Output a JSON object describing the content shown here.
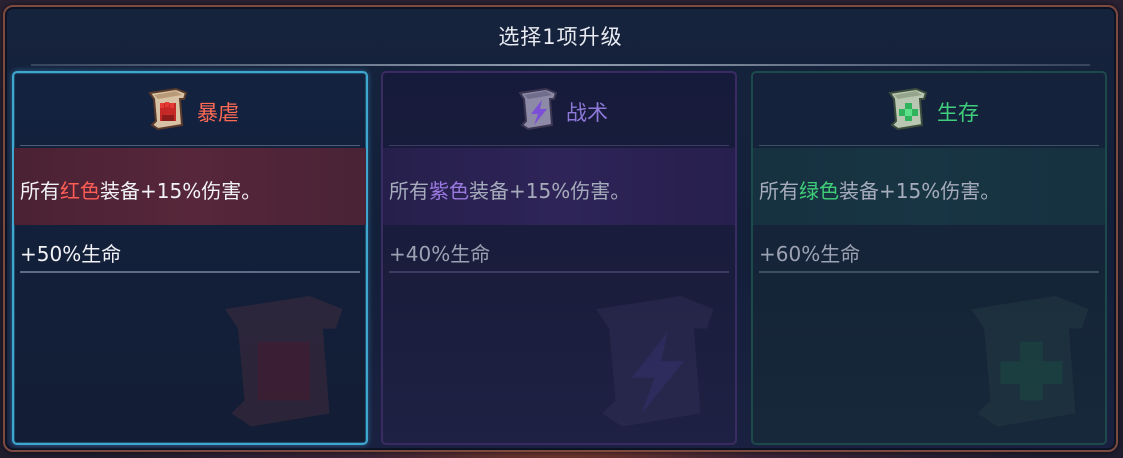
{
  "panel": {
    "title": "选择1项升级"
  },
  "cards": [
    {
      "category": "暴虐",
      "icon": "red-fist-scroll-icon",
      "accent": "#ff6a55",
      "desc_prefix": "所有",
      "desc_highlight": "红色",
      "desc_suffix": "装备+15%伤害。",
      "bonus": "+50%生命",
      "selected": true
    },
    {
      "category": "战术",
      "icon": "purple-lightning-scroll-icon",
      "accent": "#8d78d8",
      "desc_prefix": "所有",
      "desc_highlight": "紫色",
      "desc_suffix": "装备+15%伤害。",
      "bonus": "+40%生命",
      "selected": false
    },
    {
      "category": "生存",
      "icon": "green-cross-scroll-icon",
      "accent": "#3fcf7c",
      "desc_prefix": "所有",
      "desc_highlight": "绿色",
      "desc_suffix": "装备+15%伤害。",
      "bonus": "+60%生命",
      "selected": false
    }
  ]
}
